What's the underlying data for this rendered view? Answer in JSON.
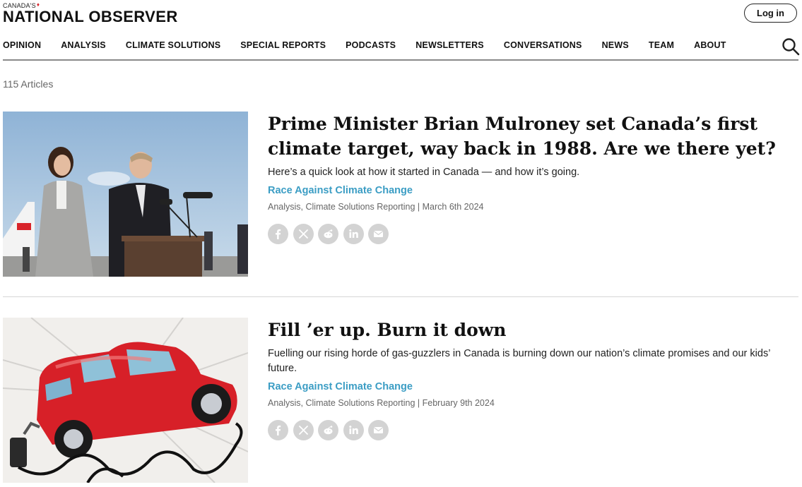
{
  "header": {
    "logo_small": "CANADA'S",
    "logo_main": "NATIONAL OBSERVER",
    "login_label": "Log in"
  },
  "nav": {
    "items": [
      "OPINION",
      "ANALYSIS",
      "CLIMATE SOLUTIONS",
      "SPECIAL REPORTS",
      "PODCASTS",
      "NEWSLETTERS",
      "CONVERSATIONS",
      "NEWS",
      "TEAM",
      "ABOUT"
    ]
  },
  "listing": {
    "count_label": "115 Articles"
  },
  "articles": [
    {
      "headline": "Prime Minister Brian Mulroney set Canada’s first climate target, way back in 1988. Are we there yet?",
      "summary": "Here’s a quick look at how it started in Canada — and how it’s going.",
      "series": "Race Against Climate Change",
      "meta": "Analysis, Climate Solutions Reporting | March 6th 2024"
    },
    {
      "headline": "Fill ’er up. Burn it down",
      "summary": "Fuelling our rising horde of gas-guzzlers in Canada is burning down our nation’s climate promises and our kids’ future.",
      "series": "Race Against Climate Change",
      "meta": "Analysis, Climate Solutions Reporting | February 9th 2024"
    }
  ],
  "share_icons": [
    "facebook-icon",
    "x-icon",
    "reddit-icon",
    "linkedin-icon",
    "email-icon"
  ],
  "colors": {
    "series_link": "#3b9dc4",
    "share_bg": "#d3d3d3",
    "logo_leaf": "#d8232a"
  }
}
